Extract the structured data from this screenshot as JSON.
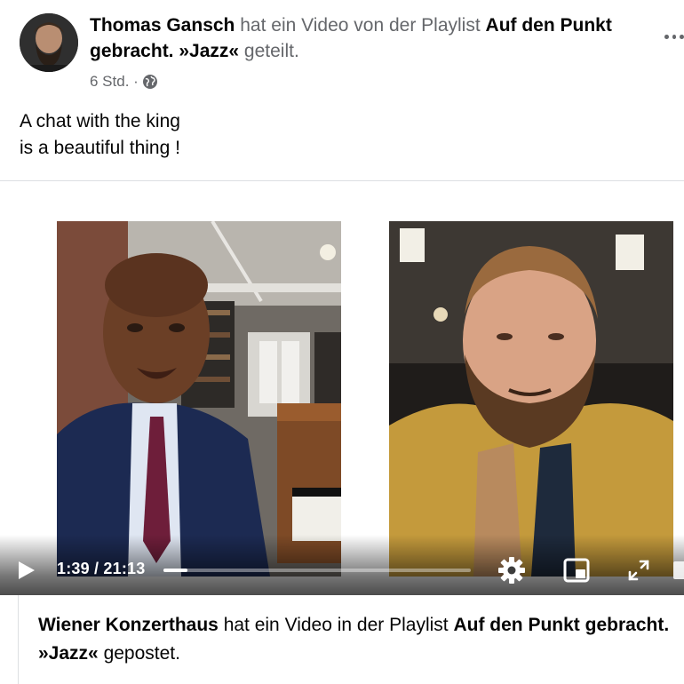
{
  "post": {
    "author": "Thomas Gansch",
    "action_text": "hat ein Video von der Playlist",
    "playlist": "Auf den Punkt gebracht. »Jazz«",
    "action_suffix": "geteilt.",
    "timestamp": "6 Std. ·",
    "privacy_icon": "globe-icon",
    "more_icon": "more-options-icon",
    "text_lines": [
      "A chat with the king",
      "is a beautiful thing !"
    ]
  },
  "video": {
    "play_icon": "play-icon",
    "current_time": "1:39",
    "duration": "21:13",
    "time_display": "1:39 / 21:13",
    "progress": 0.078,
    "settings_icon": "gear-icon",
    "pip_icon": "picture-in-picture-icon",
    "fullscreen_icon": "fullscreen-icon"
  },
  "shared_from": {
    "page": "Wiener Konzerthaus",
    "action_text": "hat ein Video in der Playlist",
    "playlist": "Auf den Punkt gebracht. »Jazz«",
    "action_suffix": "gepostet."
  },
  "colors": {
    "text_primary": "#050505",
    "text_secondary": "#65676b",
    "divider": "#dddfe2"
  }
}
